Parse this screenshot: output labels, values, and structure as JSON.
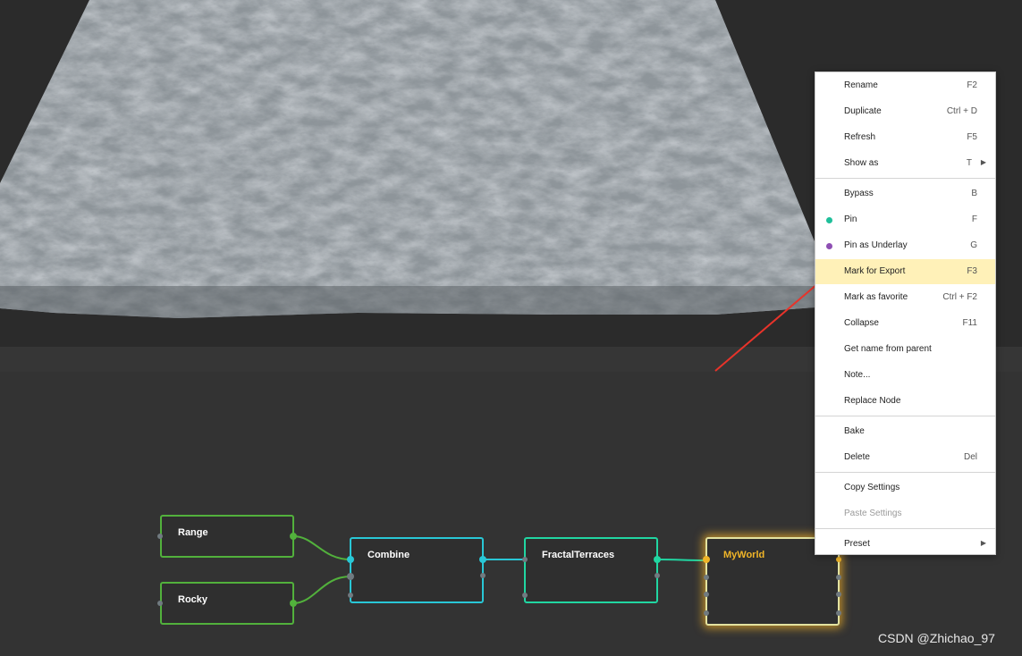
{
  "graph": {
    "nodes": [
      {
        "id": "range",
        "label": "Range"
      },
      {
        "id": "rocky",
        "label": "Rocky"
      },
      {
        "id": "combine",
        "label": "Combine"
      },
      {
        "id": "fractal",
        "label": "FractalTerraces"
      },
      {
        "id": "myworld",
        "label": "MyWorld"
      }
    ]
  },
  "context_menu": {
    "items": [
      {
        "label": "Rename",
        "shortcut": "F2"
      },
      {
        "label": "Duplicate",
        "shortcut": "Ctrl + D"
      },
      {
        "label": "Refresh",
        "shortcut": "F5"
      },
      {
        "label": "Show as",
        "shortcut": "T"
      },
      {
        "label": "Bypass",
        "shortcut": "B"
      },
      {
        "label": "Pin",
        "shortcut": "F"
      },
      {
        "label": "Pin as Underlay",
        "shortcut": "G"
      },
      {
        "label": "Mark for Export",
        "shortcut": "F3"
      },
      {
        "label": "Mark as favorite",
        "shortcut": "Ctrl + F2"
      },
      {
        "label": "Collapse",
        "shortcut": "F11"
      },
      {
        "label": "Get name from parent",
        "shortcut": ""
      },
      {
        "label": "Note...",
        "shortcut": ""
      },
      {
        "label": "Replace Node",
        "shortcut": ""
      },
      {
        "label": "Bake",
        "shortcut": ""
      },
      {
        "label": "Delete",
        "shortcut": "Del"
      },
      {
        "label": "Copy Settings",
        "shortcut": ""
      },
      {
        "label": "Paste Settings",
        "shortcut": ""
      },
      {
        "label": "Preset",
        "shortcut": ""
      }
    ],
    "pin_dot_color": "#1fbf9a",
    "underlay_dot_color": "#8e4fb3",
    "highlight_color": "#fff1b8"
  },
  "watermark": "CSDN @Zhichao_97",
  "colors": {
    "green_node": "#52b13c",
    "combine_node": "#29c7d6",
    "fractal_node": "#21d6a2",
    "output_glow": "#f0b528",
    "annotation_arrow": "#e8332a"
  }
}
